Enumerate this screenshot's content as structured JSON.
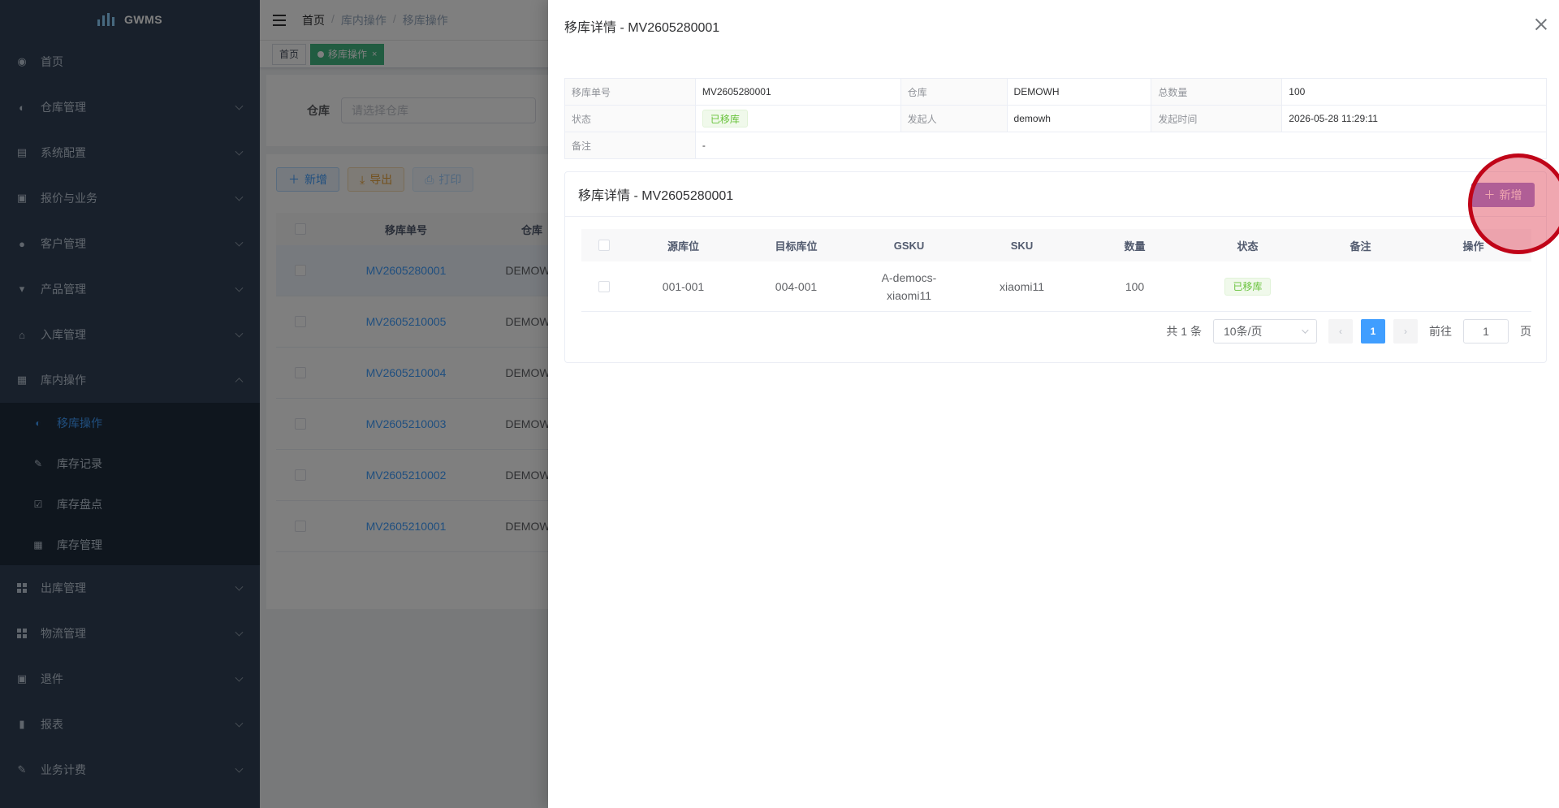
{
  "app": {
    "name": "GWMS"
  },
  "sidebar": {
    "items": [
      {
        "label": "首页",
        "icon": "dashboard-icon"
      },
      {
        "label": "仓库管理",
        "icon": "globe-icon"
      },
      {
        "label": "系统配置",
        "icon": "document-icon"
      },
      {
        "label": "报价与业务",
        "icon": "clipboard-icon"
      },
      {
        "label": "客户管理",
        "icon": "user-icon"
      },
      {
        "label": "产品管理",
        "icon": "cart-icon"
      },
      {
        "label": "入库管理",
        "icon": "home-icon"
      },
      {
        "label": "库内操作",
        "icon": "table-icon"
      }
    ],
    "submenu": [
      {
        "label": "移库操作",
        "icon": "eye-icon"
      },
      {
        "label": "库存记录",
        "icon": "edit-icon"
      },
      {
        "label": "库存盘点",
        "icon": "checkbox-icon"
      },
      {
        "label": "库存管理",
        "icon": "table-icon"
      }
    ],
    "items_after": [
      {
        "label": "出库管理",
        "icon": "grid-icon"
      },
      {
        "label": "物流管理",
        "icon": "grid-icon"
      },
      {
        "label": "退件",
        "icon": "clipboard-icon"
      },
      {
        "label": "报表",
        "icon": "chart-icon"
      },
      {
        "label": "业务计费",
        "icon": "edit-icon"
      }
    ]
  },
  "navbar": {
    "breadcrumb": [
      "首页",
      "库内操作",
      "移库操作"
    ]
  },
  "tags": {
    "home": "首页",
    "current": "移库操作"
  },
  "search": {
    "warehouse_label": "仓库",
    "warehouse_placeholder": "请选择仓库"
  },
  "toolbar": {
    "add": "新增",
    "export": "导出",
    "print": "打印"
  },
  "list": {
    "headers": {
      "no": "移库单号",
      "warehouse": "仓库"
    },
    "rows": [
      {
        "no": "MV2605280001",
        "warehouse": "DEMOWH"
      },
      {
        "no": "MV2605210005",
        "warehouse": "DEMOWH"
      },
      {
        "no": "MV2605210004",
        "warehouse": "DEMOWH"
      },
      {
        "no": "MV2605210003",
        "warehouse": "DEMOWH"
      },
      {
        "no": "MV2605210002",
        "warehouse": "DEMOWH"
      },
      {
        "no": "MV2605210001",
        "warehouse": "DEMOWH"
      }
    ]
  },
  "drawer": {
    "title": "移库详情 - MV2605280001",
    "desc": {
      "no_label": "移库单号",
      "no_value": "MV2605280001",
      "wh_label": "仓库",
      "wh_value": "DEMOWH",
      "qty_label": "总数量",
      "qty_value": "100",
      "status_label": "状态",
      "status_value": "已移库",
      "initiator_label": "发起人",
      "initiator_value": "demowh",
      "time_label": "发起时间",
      "time_value": "2026-05-28 11:29:11",
      "remark_label": "备注",
      "remark_value": "-"
    },
    "card": {
      "title": "移库详情 - MV2605280001",
      "add_label": "新增",
      "headers": [
        "源库位",
        "目标库位",
        "GSKU",
        "SKU",
        "数量",
        "状态",
        "备注",
        "操作"
      ],
      "rows": [
        {
          "src": "001-001",
          "dst": "004-001",
          "gsku_line1": "A-democs-",
          "gsku_line2": "xiaomi11",
          "sku": "xiaomi11",
          "qty": "100",
          "status": "已移库",
          "remark": "",
          "action": ""
        }
      ]
    },
    "pager": {
      "total": "共 1 条",
      "page_size": "10条/页",
      "current": "1",
      "goto_label": "前往",
      "goto_value": "1",
      "page_suffix": "页"
    }
  },
  "colors": {
    "sidebar": "#304156",
    "primary": "#409eff",
    "success": "#67c23a",
    "highlight": "#c00418"
  }
}
